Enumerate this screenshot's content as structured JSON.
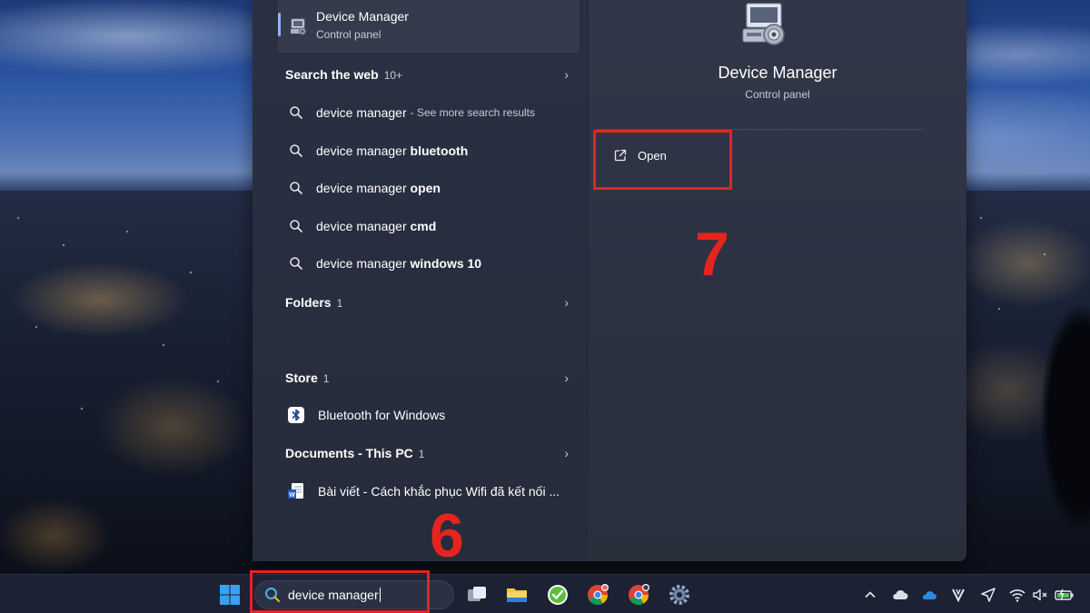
{
  "best_match": {
    "title": "Device Manager",
    "subtitle": "Control panel"
  },
  "sections": {
    "web": {
      "label": "Search the web",
      "count": "10+"
    },
    "folders": {
      "label": "Folders",
      "count": "1"
    },
    "store": {
      "label": "Store",
      "count": "1"
    },
    "documents": {
      "label": "Documents - This PC",
      "count": "1"
    }
  },
  "web_results": [
    {
      "prefix": "device manager",
      "bold": "",
      "suffix": "- See more search results"
    },
    {
      "prefix": "device manager ",
      "bold": "bluetooth",
      "suffix": ""
    },
    {
      "prefix": "device manager ",
      "bold": "open",
      "suffix": ""
    },
    {
      "prefix": "device manager ",
      "bold": "cmd",
      "suffix": ""
    },
    {
      "prefix": "device manager ",
      "bold": "windows 10",
      "suffix": ""
    }
  ],
  "store_result": {
    "label": "Bluetooth for Windows"
  },
  "document_result": {
    "label": "Bài viết - Cách khắc phục Wifi đã kết nối ..."
  },
  "details": {
    "title": "Device Manager",
    "subtitle": "Control panel",
    "open_label": "Open"
  },
  "annotations": {
    "step_search": "6",
    "step_open": "7",
    "color": "#e52420"
  },
  "taskbar": {
    "search_value": "device manager",
    "icons": [
      "windows-start-icon",
      "task-view-icon",
      "file-explorer-icon",
      "green-app-icon",
      "chrome-icon",
      "chrome-profile-icon",
      "settings-icon"
    ],
    "tray": [
      "chevron-up-icon",
      "cloud-icon",
      "onedrive-icon",
      "v-app-icon",
      "location-icon",
      "wifi-icon",
      "volume-muted-icon",
      "battery-icon"
    ]
  },
  "colors": {
    "panel_bg": "#262b3a",
    "details_bg": "#313748",
    "accent": "#8fb4ff"
  }
}
